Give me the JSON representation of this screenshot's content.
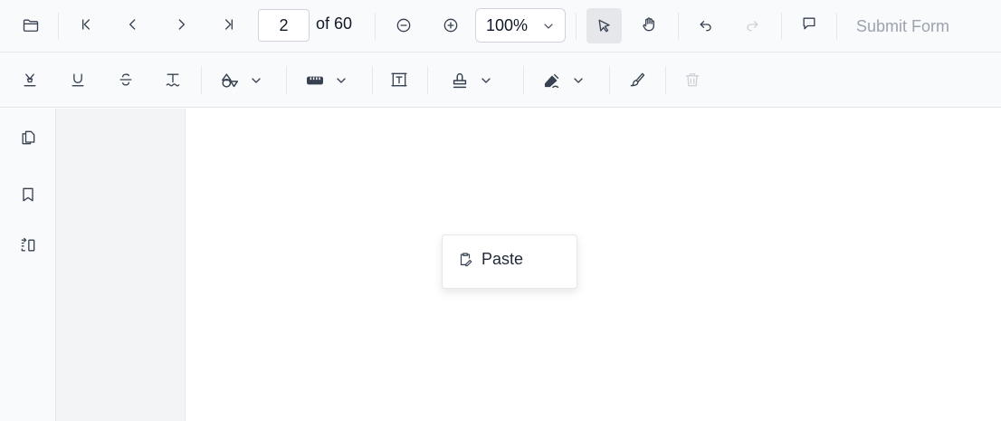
{
  "toolbar": {
    "current_page": "2",
    "page_total_label": "of 60",
    "zoom_level": "100%",
    "submit_label": "Submit Form",
    "icons": [
      "folder-icon",
      "first-page-icon",
      "previous-page-icon",
      "next-page-icon",
      "last-page-icon",
      "zoom-out-icon",
      "zoom-in-icon",
      "chevron-down-icon",
      "select-pointer-icon",
      "pan-hand-icon",
      "undo-icon",
      "redo-icon",
      "comment-icon"
    ]
  },
  "annotation_toolbar": {
    "icons": [
      "highlight-icon",
      "underline-icon",
      "strikethrough-icon",
      "squiggly-icon",
      "shape-icon",
      "measure-icon",
      "free-text-icon",
      "stamp-icon",
      "signature-icon",
      "ink-icon",
      "delete-icon"
    ]
  },
  "left_nav": {
    "icons": [
      "page-thumbnails-icon",
      "bookmark-icon",
      "organize-pages-icon"
    ]
  },
  "context_menu": {
    "items": [
      {
        "label": "Paste",
        "icon": "paste-icon"
      }
    ]
  },
  "colors": {
    "toolbar_bg": "#f9fafb",
    "border": "#e5e7eb",
    "active_button_bg": "#e5e7eb",
    "disabled_text": "#9ca3af",
    "thumbnail_panel_bg": "#f3f4f6"
  }
}
